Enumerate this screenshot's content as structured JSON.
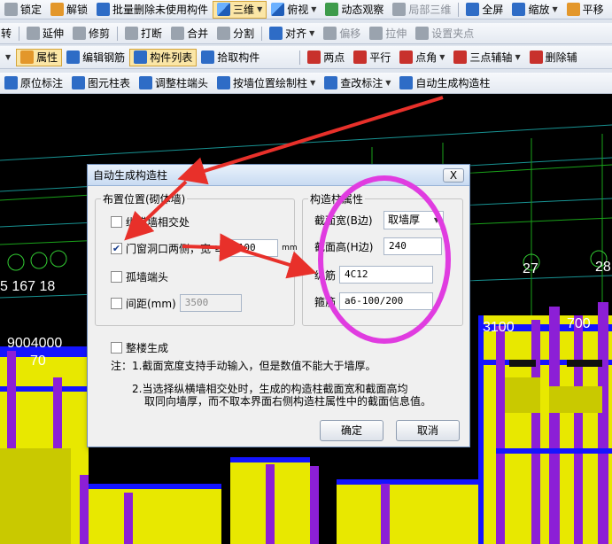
{
  "toolbar1": {
    "lock": "锁定",
    "unlock": "解锁",
    "batch_delete": "批量删除未使用构件",
    "view3d": "三维",
    "topview": "俯视",
    "dynamic": "动态观察",
    "local3d": "局部三维",
    "fullscreen": "全屏",
    "zoom": "缩放",
    "pan": "平移"
  },
  "toolbar2": {
    "stub": "转",
    "extend": "延伸",
    "trim": "修剪",
    "break": "打断",
    "merge": "合并",
    "split": "分割",
    "align": "对齐",
    "offset": "偏移",
    "stretch": "拉伸",
    "set_node": "设置夹点"
  },
  "toolbar3": {
    "property": "属性",
    "edit_rebar": "编辑钢筋",
    "component_list": "构件列表",
    "pick": "拾取构件",
    "two_points": "两点",
    "parallel": "平行",
    "point_angle": "点角",
    "three_point_aux": "三点辅轴",
    "delete_aux": "删除辅"
  },
  "toolbar4": {
    "origin_label": "原位标注",
    "element_table": "图元柱表",
    "adjust_col_end": "调整柱端头",
    "draw_col_by_wall": "按墙位置绘制柱",
    "check_label": "查改标注",
    "auto_gen": "自动生成构造柱"
  },
  "canvas_labels": {
    "n1": "5 167 18",
    "n2": "9004000",
    "n3": "70",
    "n4": "27",
    "n5": "28",
    "n6": "3100",
    "n7": "700"
  },
  "dialog": {
    "title": "自动生成构造柱",
    "close": "X",
    "position_group": "布置位置(砌体墙)",
    "opt_cross": "纵横墙相交处",
    "opt_opening_a": "门窗洞口两侧，宽",
    "opt_opening_b": "≥",
    "opening_width": "2100",
    "opening_unit": "mm",
    "opt_wall_end": "孤墙端头",
    "opt_spacing": "间距(mm)",
    "spacing_value": "3500",
    "attr_group": "构造柱属性",
    "width_label": "截面宽(B边)",
    "width_value": "取墙厚",
    "height_label": "截面高(H边)",
    "height_value": "240",
    "long_rebar_label": "纵筋",
    "long_rebar_value": "4C12",
    "stirrup_label": "箍筋",
    "stirrup_value": "a6-100/200",
    "whole_floor": "整楼生成",
    "note1": "注：1.截面宽度支持手动输入，但是数值不能大于墙厚。",
    "note2": "2.当选择纵横墙相交处时，生成的构造柱截面宽和截面高均",
    "note3": "取同向墙厚，而不取本界面右侧构造柱属性中的截面信息值。",
    "ok": "确定",
    "cancel": "取消"
  },
  "colors": {
    "annotation_red": "#e8302a",
    "annotation_magenta": "#e03ce0",
    "column_yellow": "#e8e800",
    "column_purple": "#8c1fd6",
    "wall_blue": "#1414ff"
  }
}
